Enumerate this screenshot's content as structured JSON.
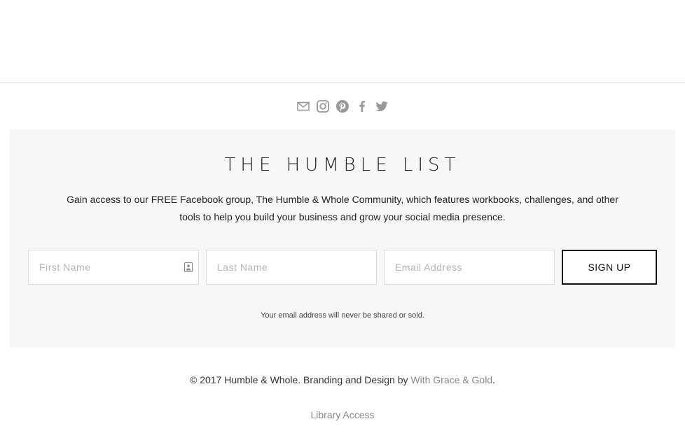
{
  "social": {
    "icons": [
      "email-icon",
      "instagram-icon",
      "pinterest-icon",
      "facebook-icon",
      "twitter-icon"
    ],
    "icon_color": "#999999"
  },
  "newsletter": {
    "title": "THE HUMBLE LIST",
    "description": "Gain access to our FREE Facebook group, The Humble & Whole Community, which features workbooks, challenges, and other tools to help you build your business and grow your social media presence.",
    "first_name_placeholder": "First Name",
    "last_name_placeholder": "Last Name",
    "email_placeholder": "Email Address",
    "first_name_value": "",
    "last_name_value": "",
    "email_value": "",
    "submit_label": "SIGN UP",
    "privacy_note": "Your email address will never be shared or sold.",
    "background": "#f7f7f7"
  },
  "footer": {
    "copyright_prefix": "© 2017 Humble & Whole. Branding and Design by ",
    "designer_link": "With Grace & Gold",
    "copyright_suffix": ".",
    "library_link": "Library Access",
    "link_color": "#888888"
  }
}
